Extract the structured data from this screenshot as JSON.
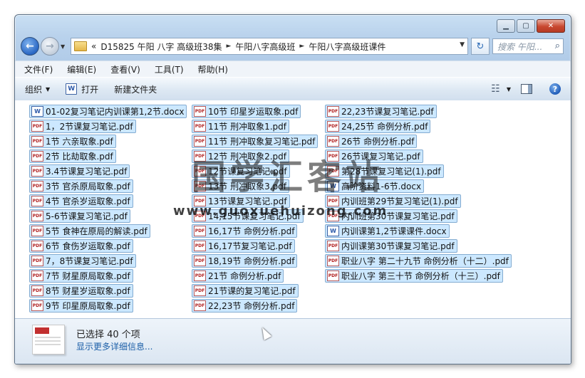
{
  "address": {
    "prefix": "«",
    "parts": [
      "D15825 午阳 八字 高级班38集",
      "午阳八字高级班",
      "午阳八字高级班课件"
    ],
    "search_placeholder": "搜索 午阳..."
  },
  "menu": [
    "文件(F)",
    "编辑(E)",
    "查看(V)",
    "工具(T)",
    "帮助(H)"
  ],
  "toolbar": {
    "organize": "组织",
    "open": "打开",
    "new_folder": "新建文件夹"
  },
  "columns": [
    [
      {
        "name": "01-02复习笔记内训课第1,2节.docx",
        "type": "docx"
      },
      {
        "name": "1，2节课复习笔记.pdf",
        "type": "pdf"
      },
      {
        "name": "1节 六亲取象.pdf",
        "type": "pdf"
      },
      {
        "name": "2节 比劫取象.pdf",
        "type": "pdf"
      },
      {
        "name": "3.4节课复习笔记.pdf",
        "type": "pdf"
      },
      {
        "name": "3节 官杀原局取象.pdf",
        "type": "pdf"
      },
      {
        "name": "4节 官杀岁运取象.pdf",
        "type": "pdf"
      },
      {
        "name": "5-6节课复习笔记.pdf",
        "type": "pdf"
      },
      {
        "name": "5节 食神在原局的解读.pdf",
        "type": "pdf"
      },
      {
        "name": "6节 食伤岁运取象.pdf",
        "type": "pdf"
      },
      {
        "name": "7，8节课复习笔记.pdf",
        "type": "pdf"
      },
      {
        "name": "7节 财星原局取象.pdf",
        "type": "pdf"
      },
      {
        "name": "8节 财星岁运取象.pdf",
        "type": "pdf"
      },
      {
        "name": "9节 印星原局取象.pdf",
        "type": "pdf"
      }
    ],
    [
      {
        "name": "10节 印星岁运取象.pdf",
        "type": "pdf"
      },
      {
        "name": "11节 刑冲取象1.pdf",
        "type": "pdf"
      },
      {
        "name": "11节 刑冲取象复习笔记.pdf",
        "type": "pdf"
      },
      {
        "name": "12节 刑冲取象2.pdf",
        "type": "pdf"
      },
      {
        "name": "12节课复习笔记.pdf",
        "type": "pdf"
      },
      {
        "name": "13节 刑冲取象3.pdf",
        "type": "pdf"
      },
      {
        "name": "13节课复习笔记.pdf",
        "type": "pdf"
      },
      {
        "name": "14,15节课复习笔记.pdf",
        "type": "pdf"
      },
      {
        "name": "16,17节 命例分析.pdf",
        "type": "pdf"
      },
      {
        "name": "16,17节复习笔记.pdf",
        "type": "pdf"
      },
      {
        "name": "18,19节 命例分析.pdf",
        "type": "pdf"
      },
      {
        "name": "21节 命例分析.pdf",
        "type": "pdf"
      },
      {
        "name": "21节课的复习笔记.pdf",
        "type": "pdf"
      },
      {
        "name": "22,23节 命例分析.pdf",
        "type": "pdf"
      }
    ],
    [
      {
        "name": "22,23节课复习笔记.pdf",
        "type": "pdf"
      },
      {
        "name": "24,25节 命例分析.pdf",
        "type": "pdf"
      },
      {
        "name": "26节 命例分析.pdf",
        "type": "pdf"
      },
      {
        "name": "26节课复习笔记.pdf",
        "type": "pdf"
      },
      {
        "name": "第28节课复习笔记(1).pdf",
        "type": "pdf"
      },
      {
        "name": "高阶资料1-6节.docx",
        "type": "docx"
      },
      {
        "name": "内训班第29节复习笔记(1).pdf",
        "type": "pdf"
      },
      {
        "name": "内训班第30节课复习笔记.pdf",
        "type": "pdf"
      },
      {
        "name": "内训课第1,2节课课件.docx",
        "type": "docx"
      },
      {
        "name": "内训课第30节课复习笔记.pdf",
        "type": "pdf"
      },
      {
        "name": "职业八字 第二十九节 命例分析（十二）.pdf",
        "type": "pdf"
      },
      {
        "name": "职业八字 第三十节 命例分析（十三）.pdf",
        "type": "pdf"
      }
    ]
  ],
  "watermark": {
    "title": "国学汇客站",
    "url": "www.guoxuehuizong.com"
  },
  "status": {
    "selected": "已选择 40 个项",
    "more": "显示更多详细信息..."
  },
  "icons": {
    "pdf_label": "PDF",
    "doc_label": "W"
  },
  "colors": {
    "selection_bg": "#cce8ff",
    "selection_border": "#84acd1",
    "link": "#1c5fa8"
  }
}
